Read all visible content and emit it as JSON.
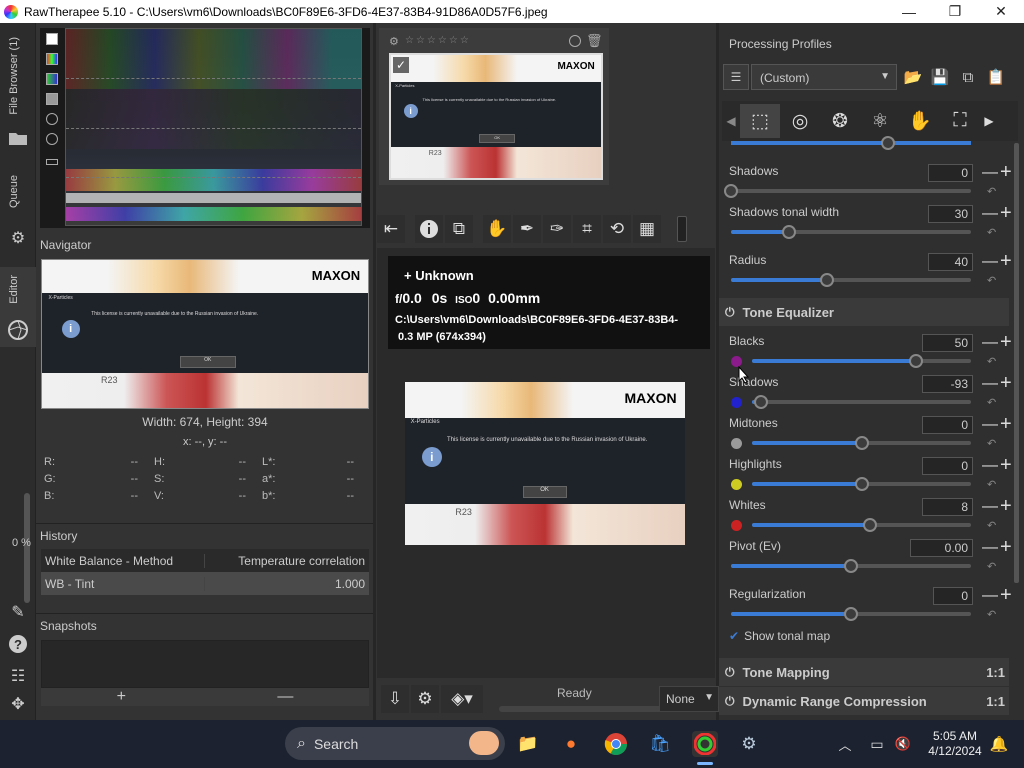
{
  "window": {
    "title": "RawTherapee 5.10 - C:\\Users\\vm6\\Downloads\\BC0F89E6-3FD6-4E37-83B4-91D86A0D57F6.jpeg",
    "minimize": "—",
    "maximize": "❐",
    "close": "✕"
  },
  "left_toolbar": {
    "file_browser": "File Browser (1)",
    "queue": "Queue",
    "editor": "Editor",
    "zoom": "0 %"
  },
  "navigator": {
    "title": "Navigator",
    "size_text": "Width: 674, Height: 394",
    "coords": "x: --, y: --",
    "values": [
      [
        "R:",
        "--",
        "H:",
        "--",
        "L*:",
        "--"
      ],
      [
        "G:",
        "--",
        "S:",
        "--",
        "a*:",
        "--"
      ],
      [
        "B:",
        "--",
        "V:",
        "--",
        "b*:",
        "--"
      ]
    ]
  },
  "image_text": {
    "logo": "MAXON",
    "product": "X-Particles",
    "message": "This license is currently unavailable due to the Russian invasion of Ukraine.",
    "ok": "OK",
    "r23": "R23",
    "info": "i"
  },
  "history": {
    "title": "History",
    "rows": [
      {
        "name": "White Balance - Method",
        "value": "Temperature correlation"
      },
      {
        "name": "WB - Tint",
        "value": "1.000"
      }
    ]
  },
  "snapshots": {
    "title": "Snapshots",
    "add": "+",
    "remove": "—"
  },
  "exif": {
    "camera": "+  Unknown",
    "aperture_prefix": "f/",
    "aperture": "0.0",
    "shutter": "0s",
    "iso_prefix": "ISO",
    "iso": "0",
    "focal": "0.00mm",
    "path": "C:\\Users\\vm6\\Downloads\\BC0F89E6-3FD6-4E37-83B4-",
    "size": "0.3 MP (674x394)"
  },
  "status": {
    "ready": "Ready",
    "profile_select": "None"
  },
  "processing_profiles": {
    "title": "Processing Profiles",
    "current": "(Custom)"
  },
  "shadows_section": [
    {
      "label": "Shadows",
      "value": "0",
      "fraction": 0.0
    },
    {
      "label": "Shadows tonal width",
      "value": "30",
      "fraction": 0.24
    },
    {
      "label": "Radius",
      "value": "40",
      "fraction": 0.4
    }
  ],
  "tone_equalizer": {
    "title": "Tone Equalizer",
    "bands": [
      {
        "label": "Blacks",
        "value": "50",
        "color": "#8b1a8b",
        "fraction": 0.75
      },
      {
        "label": "Shadows",
        "value": "-93",
        "color": "#2222cc",
        "fraction": 0.04
      },
      {
        "label": "Midtones",
        "value": "0",
        "color": "#9a9a9a",
        "fraction": 0.5
      },
      {
        "label": "Highlights",
        "value": "0",
        "color": "#cccc22",
        "fraction": 0.5
      },
      {
        "label": "Whites",
        "value": "8",
        "color": "#cc2222",
        "fraction": 0.54
      }
    ],
    "pivot": {
      "label": "Pivot (Ev)",
      "value": "0.00",
      "fraction": 0.5
    },
    "regularization": {
      "label": "Regularization",
      "value": "0",
      "fraction": 0.5
    },
    "show_map": "Show tonal map"
  },
  "groups": [
    {
      "title": "Tone Mapping",
      "ratio": "1:1"
    },
    {
      "title": "Dynamic Range Compression",
      "ratio": "1:1"
    }
  ],
  "taskbar": {
    "search": "Search",
    "time": "5:05 AM",
    "date": "4/12/2024"
  }
}
